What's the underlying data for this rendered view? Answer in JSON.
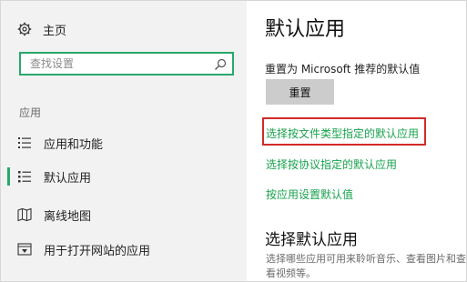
{
  "sidebar": {
    "home": {
      "label": "主页",
      "icon": "gear-icon"
    },
    "search": {
      "placeholder": "查找设置",
      "icon": "search-icon"
    },
    "section_label": "应用",
    "items": [
      {
        "label": "应用和功能",
        "icon": "apps-list-icon",
        "selected": false
      },
      {
        "label": "默认应用",
        "icon": "default-apps-icon",
        "selected": true
      },
      {
        "label": "离线地图",
        "icon": "map-icon",
        "selected": false
      },
      {
        "label": "用于打开网站的应用",
        "icon": "website-app-icon",
        "selected": false
      }
    ]
  },
  "main": {
    "title": "默认应用",
    "reset_label": "重置为 Microsoft 推荐的默认值",
    "reset_button": "重置",
    "links": [
      "选择按文件类型指定的默认应用",
      "选择按协议指定的默认应用",
      "按应用设置默认值"
    ],
    "subheading": "选择默认应用",
    "description": "选择哪些应用可用来聆听音乐、查看图片和查看视频等。"
  },
  "colors": {
    "accent": "#18a34e",
    "highlight": "#d32a2a",
    "sidebar_bg": "#f2f2f2",
    "button_bg": "#cccccc"
  }
}
